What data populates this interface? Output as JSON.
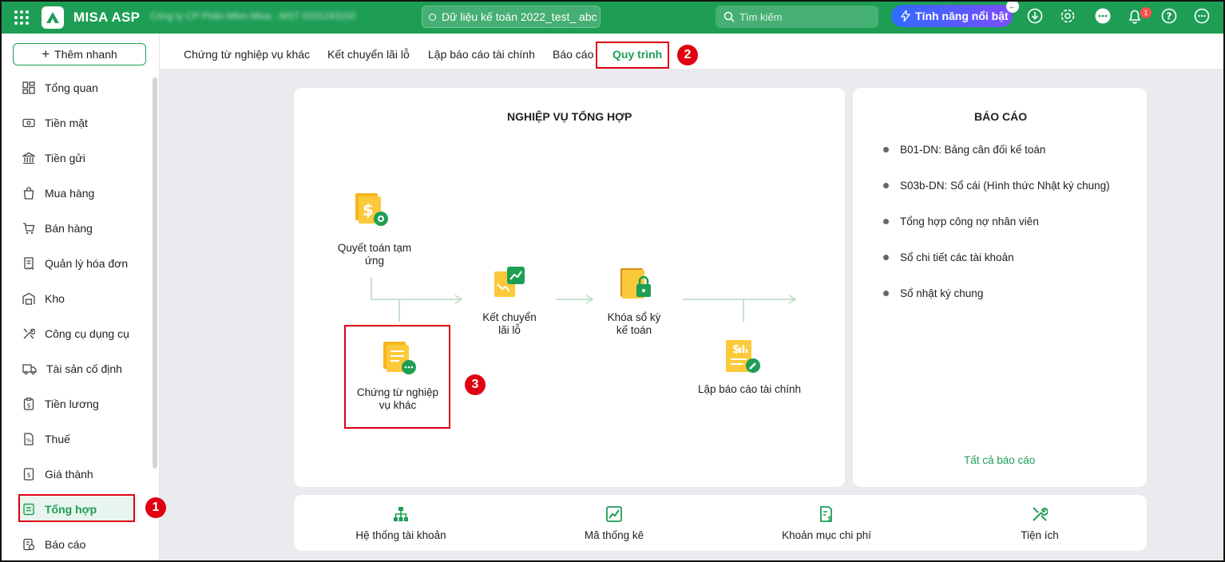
{
  "topbar": {
    "app_name": "MISA ASP",
    "company_name": "Công ty CP Phần Mềm Misa - MST 0101243150",
    "database_label": "Dữ liệu kế toán 2022_test_ abc",
    "search_placeholder": "Tìm kiếm",
    "featured_label": "Tính năng nổi bật",
    "notification_count": "1"
  },
  "sidebar": {
    "add_quick": "Thêm nhanh",
    "items": [
      {
        "label": "Tổng quan",
        "icon": "dashboard-icon"
      },
      {
        "label": "Tiền mặt",
        "icon": "cash-icon"
      },
      {
        "label": "Tiền gửi",
        "icon": "bank-icon"
      },
      {
        "label": "Mua hàng",
        "icon": "shopping-bag-icon"
      },
      {
        "label": "Bán hàng",
        "icon": "cart-icon"
      },
      {
        "label": "Quản lý hóa đơn",
        "icon": "invoice-icon"
      },
      {
        "label": "Kho",
        "icon": "warehouse-icon"
      },
      {
        "label": "Công cụ dụng cụ",
        "icon": "tools-icon"
      },
      {
        "label": "Tài sản cố định",
        "icon": "truck-icon"
      },
      {
        "label": "Tiền lương",
        "icon": "salary-icon"
      },
      {
        "label": "Thuế",
        "icon": "tax-icon"
      },
      {
        "label": "Giá thành",
        "icon": "cost-icon"
      },
      {
        "label": "Tổng hợp",
        "icon": "summary-icon"
      },
      {
        "label": "Báo cáo",
        "icon": "report-icon"
      }
    ],
    "active_index": 12
  },
  "tabs": [
    {
      "label": "Chứng từ nghiệp vụ khác"
    },
    {
      "label": "Kết chuyển lãi lỗ"
    },
    {
      "label": "Lập báo cáo tài chính"
    },
    {
      "label": "Báo cáo"
    },
    {
      "label": "Quy trình"
    }
  ],
  "process": {
    "title": "NGHIỆP VỤ TỔNG HỢP",
    "steps": {
      "settlement": "Quyết toán tạm ứng",
      "other_vouchers": "Chứng từ nghiệp vụ khác",
      "profit_transfer": "Kết chuyển lãi lỗ",
      "lock_period": "Khóa sổ kỳ kế toán",
      "financial_report": "Lập báo cáo tài chính"
    }
  },
  "reports": {
    "title": "BÁO CÁO",
    "items": [
      "B01-DN: Bảng cân đối kế toán",
      "S03b-DN: Sổ cái (Hình thức Nhật ký chung)",
      "Tổng hợp công nợ nhân viên",
      "Sổ chi tiết các tài khoản",
      "Sổ nhật ký chung"
    ],
    "all_link": "Tất cả báo cáo"
  },
  "tools": [
    {
      "label": "Hệ thống tài khoản",
      "icon": "account-tree-icon"
    },
    {
      "label": "Mã thống kê",
      "icon": "chart-icon"
    },
    {
      "label": "Khoản mục chi phí",
      "icon": "expense-icon"
    },
    {
      "label": "Tiện ích",
      "icon": "utility-icon"
    }
  ],
  "callouts": [
    "1",
    "2",
    "3"
  ],
  "colors": {
    "brand": "#1e9e55",
    "highlight": "#e00012",
    "accent": "#2f6bff"
  }
}
